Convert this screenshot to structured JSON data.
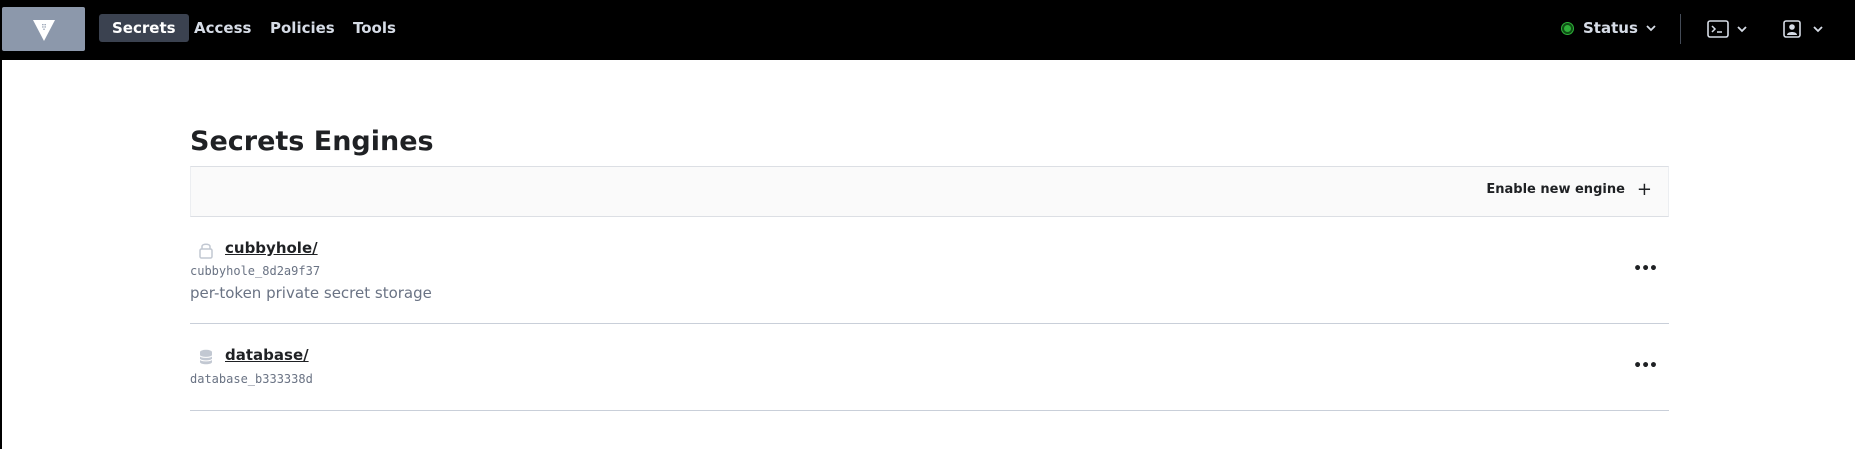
{
  "nav": {
    "items": [
      {
        "label": "Secrets",
        "active": true
      },
      {
        "label": "Access",
        "active": false
      },
      {
        "label": "Policies",
        "active": false
      },
      {
        "label": "Tools",
        "active": false
      }
    ],
    "status_label": "Status",
    "status_color": "#2eb039"
  },
  "page": {
    "title": "Secrets Engines",
    "enable_button": "Enable new engine",
    "enable_icon": "+"
  },
  "engines": [
    {
      "path": "cubbyhole/",
      "accessor": "cubbyhole_8d2a9f37",
      "description": "per-token private secret storage",
      "icon": "lock-icon"
    },
    {
      "path": "database/",
      "accessor": "database_b333338d",
      "description": "",
      "icon": "database-icon"
    }
  ],
  "row_menu_label": "•••"
}
